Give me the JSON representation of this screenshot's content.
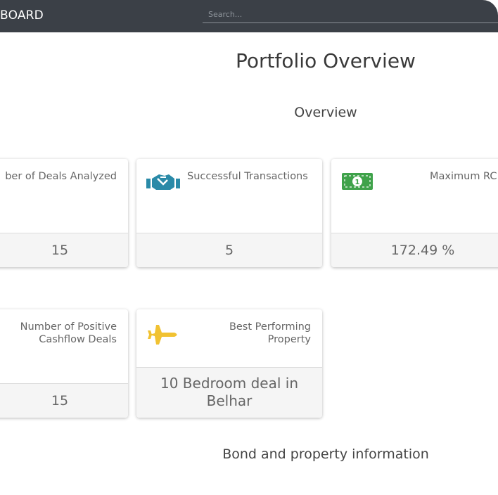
{
  "header": {
    "brand": "BOARD",
    "search_placeholder": "Search..."
  },
  "page": {
    "title": "Portfolio Overview",
    "overview_heading": "Overview",
    "bond_heading": "Bond and property information"
  },
  "cards": [
    {
      "label": "Number of Deals Analyzed",
      "visible_label": "ber of Deals Analyzed",
      "value": "15",
      "icon": "none"
    },
    {
      "label": "Successful Transactions",
      "value": "5",
      "icon": "handshake-icon",
      "icon_color": "#2a8aa8"
    },
    {
      "label": "Maximum RC",
      "value": "172.49 %",
      "icon": "money-icon",
      "icon_color": "#3fa24a"
    },
    {
      "label": "Number of Positive Cashflow Deals",
      "value": "15",
      "icon": "none"
    },
    {
      "label": "Best Performing Property",
      "value": "10 Bedroom deal in Belhar",
      "icon": "jet-icon",
      "icon_color": "#f1c232"
    }
  ]
}
